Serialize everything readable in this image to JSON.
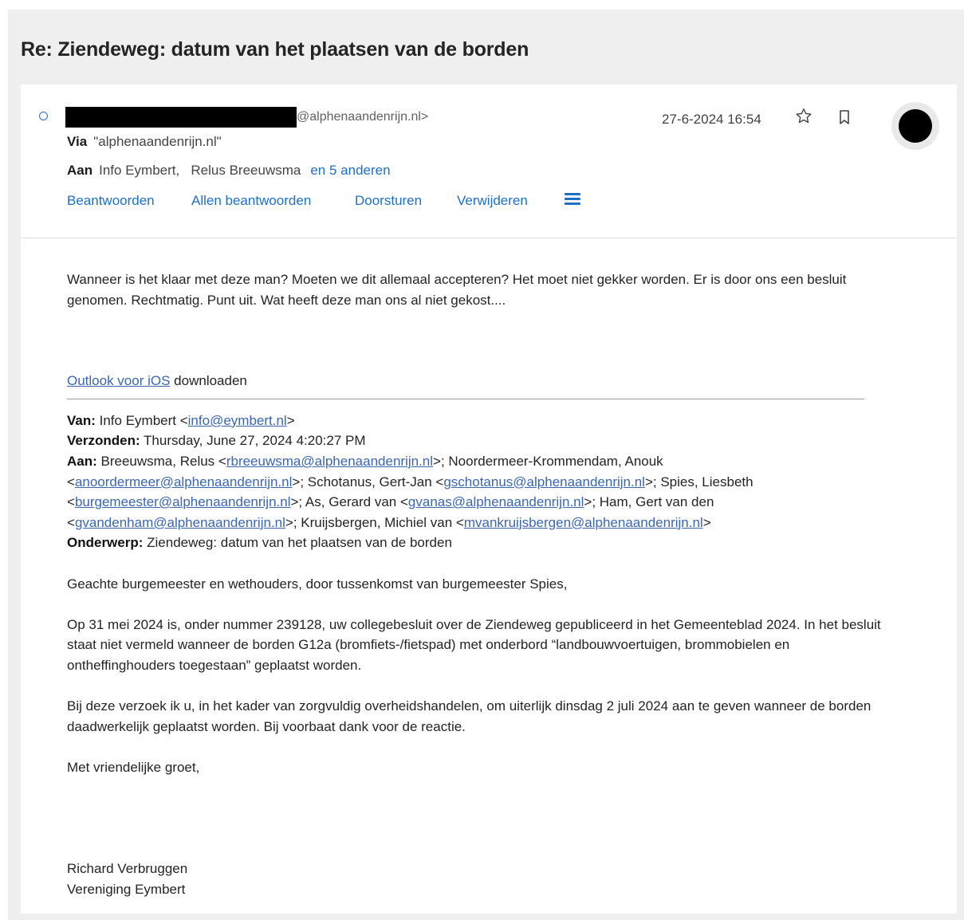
{
  "subject": "Re: Ziendeweg: datum van het plaatsen van de borden",
  "header": {
    "from_email": "@alphenaandenrijn.nl>",
    "date": "27-6-2024 16:54",
    "via_label": "Via",
    "via_value": "\"alphenaandenrijn.nl\"",
    "to_label": "Aan",
    "to_recipients": "Info Eymbert,   Relus Breeuwsma",
    "to_more": "en 5 anderen",
    "icons": [
      "unread-indicator",
      "star-icon",
      "bookmark-icon",
      "menu-icon",
      "avatar"
    ]
  },
  "actions": {
    "reply": "Beantwoorden",
    "reply_all": "Allen beantwoorden",
    "forward": "Doorsturen",
    "delete": "Verwijderen"
  },
  "body": {
    "reply_text": "Wanneer is het klaar met deze man? Moeten we dit allemaal accepteren? Het moet niet gekker worden. Er is door ons een besluit genomen. Rechtmatig. Punt uit. Wat heeft deze man ons al niet gekost....",
    "outlook_link": "Outlook voor iOS",
    "outlook_suffix": " downloaden",
    "quoted": {
      "from_label": "Van:",
      "from_name": " Info Eymbert <",
      "from_email": "info@eymbert.nl",
      "sent_label": "Verzonden:",
      "sent_value": " Thursday, June 27, 2024 4:20:27 PM",
      "to_label": "Aan:",
      "to_1_name": " Breeuwsma, Relus <",
      "to_1_email": "rbreeuwsma@alphenaandenrijn.nl",
      "to_2_name": ">; Noordermeer-Krommendam, Anouk <",
      "to_2_email": "anoordermeer@alphenaandenrijn.nl",
      "to_3_name": ">; Schotanus, Gert-Jan <",
      "to_3_email": "gschotanus@alphenaandenrijn.nl",
      "to_4_name": ">; Spies, Liesbeth <",
      "to_4_email": "burgemeester@alphenaandenrijn.nl",
      "to_5_name": ">; As, Gerard van <",
      "to_5_email": "gvanas@alphenaandenrijn.nl",
      "to_6_name": ">; Ham, Gert van den <",
      "to_6_email": "gvandenham@alphenaandenrijn.nl",
      "to_7_name": ">; Kruijsbergen, Michiel van <",
      "to_7_email": "mvankruijsbergen@alphenaandenrijn.nl",
      "subject_label": "Onderwerp:",
      "subject_value": " Ziendeweg: datum van het plaatsen van de borden"
    },
    "p1": "Geachte burgemeester en wethouders, door tussenkomst van burgemeester Spies,",
    "p2": "Op 31 mei 2024 is, onder nummer 239128, uw collegebesluit over de Ziendeweg gepubliceerd in het Gemeenteblad 2024. In het besluit staat niet vermeld wanneer de borden G12a (bromfiets-/fietspad) met onderbord “landbouwvoertuigen, brommobielen en ontheffinghouders toegestaan” geplaatst worden.",
    "p3": "Bij deze verzoek ik u, in het kader van zorgvuldig overheidshandelen, om uiterlijk dinsdag 2 juli 2024 aan te geven wanneer de borden daadwerkelijk geplaatst worden. Bij voorbaat dank voor de reactie.",
    "closing": "Met vriendelijke groet,",
    "signature_name": "Richard Verbruggen",
    "signature_org": "Vereniging Eymbert"
  }
}
